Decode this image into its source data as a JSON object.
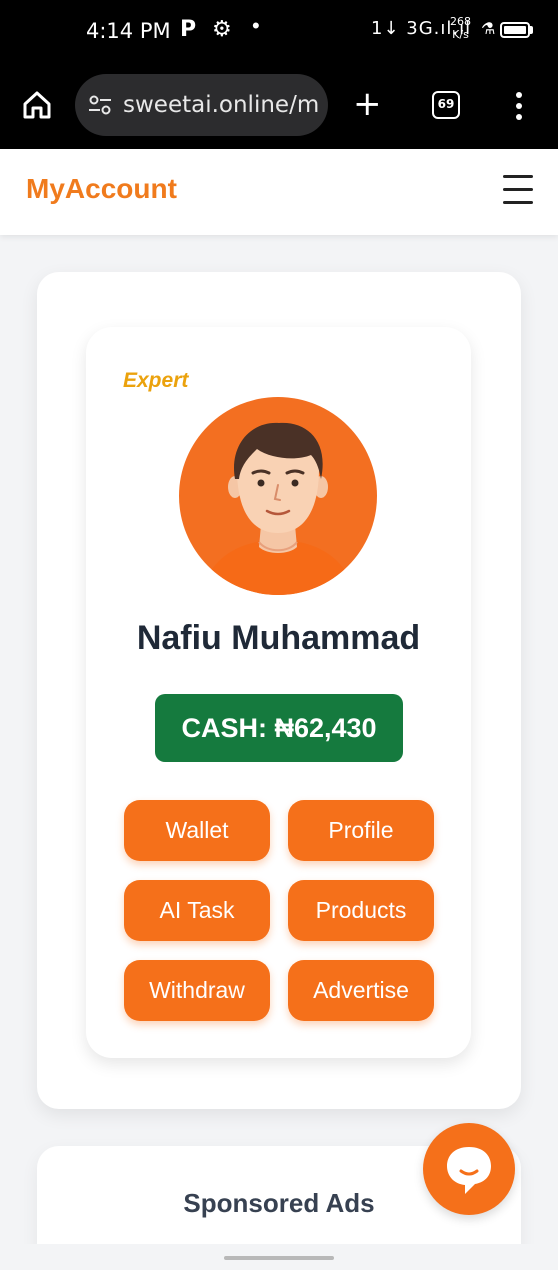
{
  "status_bar": {
    "time": "4:14 PM",
    "p_glyph": "P",
    "dot": "•",
    "network": "1↓ 3G.ıl.ıl",
    "speed_value": "268",
    "speed_unit": "K/s"
  },
  "browser": {
    "url": "sweetai.online/m",
    "tab_count": "69",
    "plus_glyph": "+"
  },
  "header": {
    "brand": "MyAccount"
  },
  "profile": {
    "rank": "Expert",
    "name": "Nafiu Muhammad",
    "cash_label": "CASH: ₦62,430"
  },
  "actions": {
    "wallet": "Wallet",
    "profile": "Profile",
    "ai_task": "AI Task",
    "products": "Products",
    "withdraw": "Withdraw",
    "advertise": "Advertise"
  },
  "ads": {
    "title": "Sponsored Ads"
  },
  "colors": {
    "accent": "#f5701a",
    "brand": "#f07b1d",
    "cash_bg": "#157a3e",
    "rank": "#eba20d"
  },
  "icons": [
    "home-icon",
    "tune-icon",
    "plus-icon",
    "tabs-icon",
    "menu-dots-icon",
    "hamburger-icon",
    "avatar-illustration",
    "chat-bubble-icon",
    "gear-icon"
  ]
}
